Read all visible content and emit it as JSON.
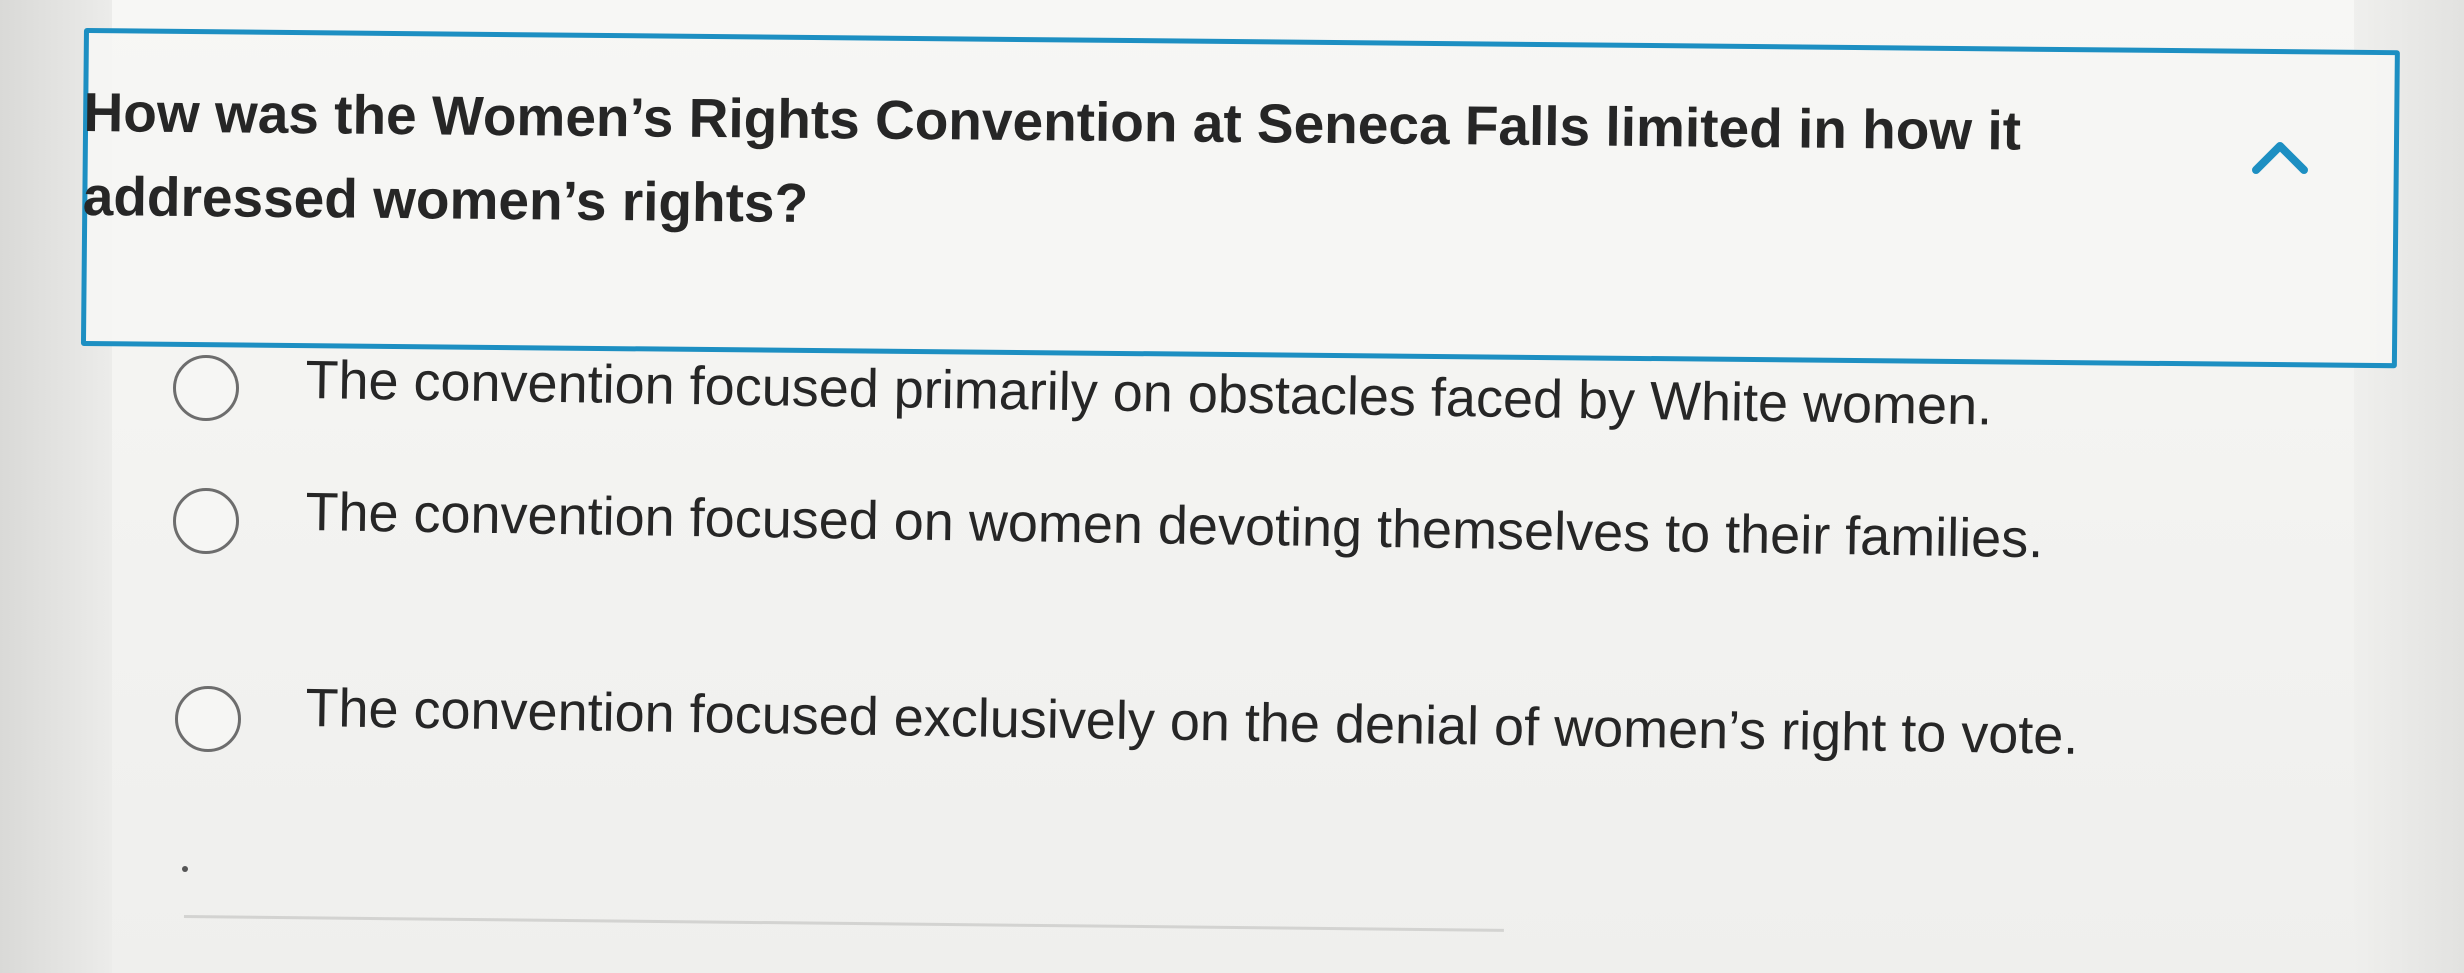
{
  "question": {
    "text": "How was the Women’s Rights Convention at Seneca Falls limited in how it addressed women’s rights?",
    "expanded": true,
    "toggle_icon": "chevron-up-icon"
  },
  "options": [
    {
      "label": "The convention focused primarily on obstacles faced by White women.",
      "selected": false
    },
    {
      "label": "The convention focused on women devoting themselves to their families.",
      "selected": false
    },
    {
      "label": "The convention focused exclusively on the denial of women’s right to vote.",
      "selected": false
    }
  ],
  "colors": {
    "accent": "#1d8fc2",
    "text": "#262626",
    "radio_border": "#6d6d6d"
  }
}
